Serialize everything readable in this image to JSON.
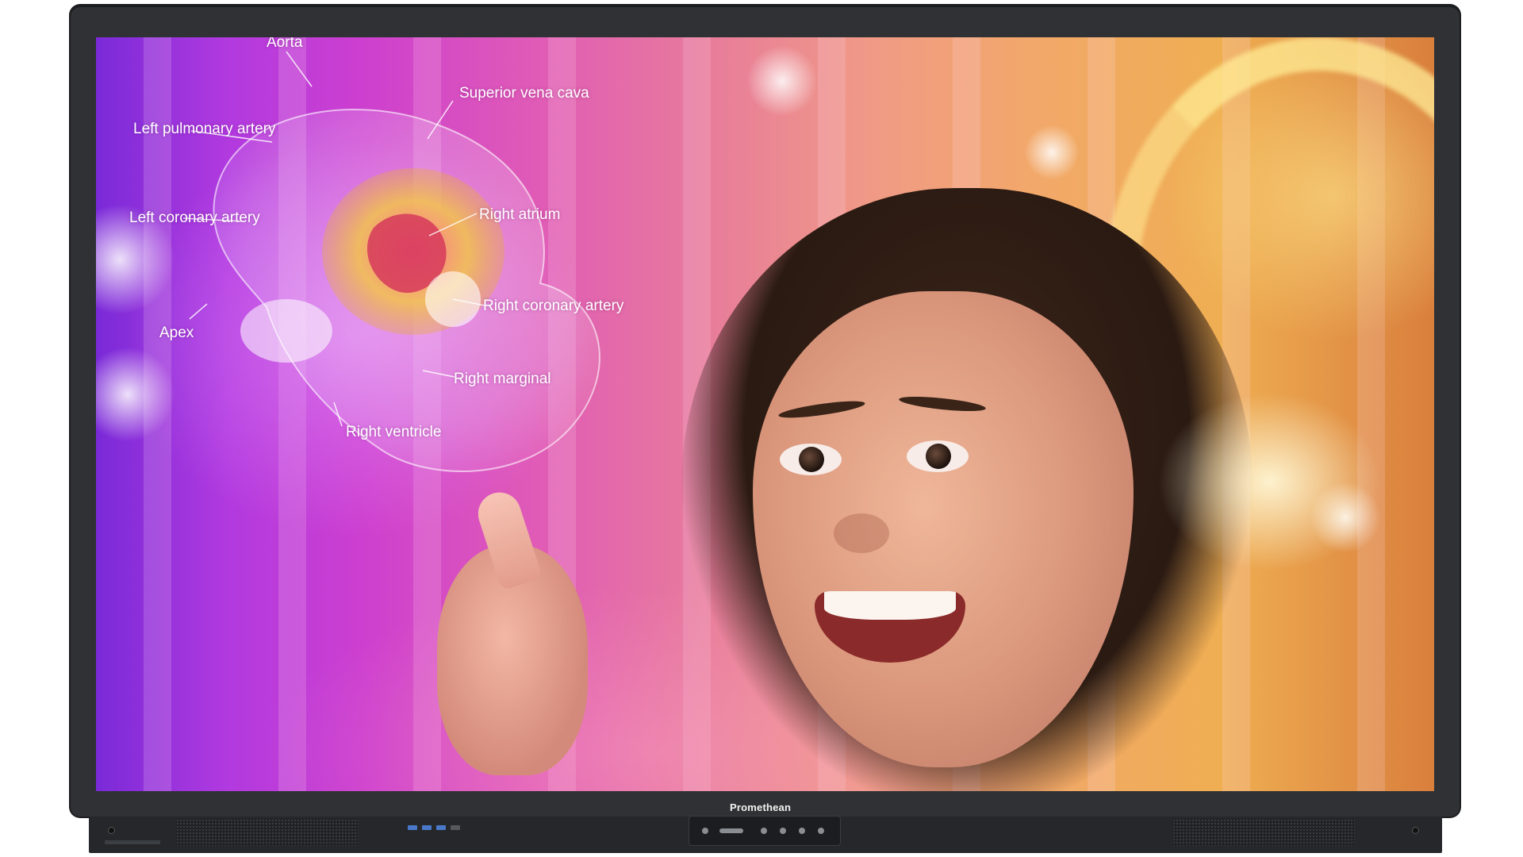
{
  "display": {
    "brand": "Promethean"
  },
  "heart_labels": {
    "aorta": "Aorta",
    "superior_vena_cava": "Superior vena cava",
    "left_pulmonary_artery": "Left pulmonary artery",
    "left_coronary_artery": "Left coronary artery",
    "right_atrium": "Right atrium",
    "right_coronary_artery": "Right coronary artery",
    "apex": "Apex",
    "right_marginal": "Right marginal",
    "right_ventricle": "Right ventricle"
  },
  "colors": {
    "bezel": "#2f3134",
    "label_text": "#ffffff",
    "hologram_gold": "#f2c24a"
  },
  "icons": {
    "control_pod": [
      "power-icon",
      "input-icon",
      "home-icon",
      "dot-icon",
      "dot-icon",
      "settings-icon"
    ]
  }
}
